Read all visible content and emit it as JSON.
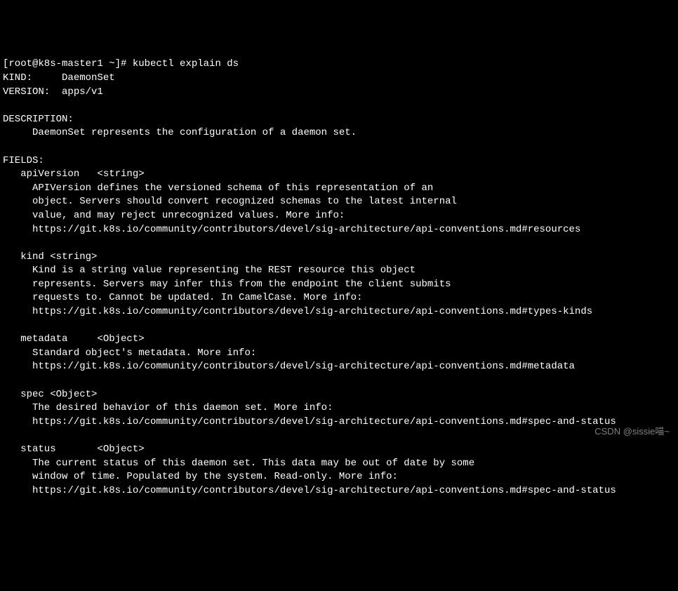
{
  "prompt": "[root@k8s-master1 ~]# kubectl explain ds",
  "kind_line": "KIND:     DaemonSet",
  "version_line": "VERSION:  apps/v1",
  "description_header": "DESCRIPTION:",
  "description_body": "     DaemonSet represents the configuration of a daemon set.",
  "fields_header": "FIELDS:",
  "apiVersion_title": "   apiVersion   <string>",
  "apiVersion_l1": "     APIVersion defines the versioned schema of this representation of an",
  "apiVersion_l2": "     object. Servers should convert recognized schemas to the latest internal",
  "apiVersion_l3": "     value, and may reject unrecognized values. More info:",
  "apiVersion_l4": "     https://git.k8s.io/community/contributors/devel/sig-architecture/api-conventions.md#resources",
  "kind_title": "   kind <string>",
  "kind_l1": "     Kind is a string value representing the REST resource this object",
  "kind_l2": "     represents. Servers may infer this from the endpoint the client submits",
  "kind_l3": "     requests to. Cannot be updated. In CamelCase. More info:",
  "kind_l4": "     https://git.k8s.io/community/contributors/devel/sig-architecture/api-conventions.md#types-kinds",
  "metadata_title": "   metadata     <Object>",
  "metadata_l1": "     Standard object's metadata. More info:",
  "metadata_l2": "     https://git.k8s.io/community/contributors/devel/sig-architecture/api-conventions.md#metadata",
  "spec_title": "   spec <Object>",
  "spec_l1": "     The desired behavior of this daemon set. More info:",
  "spec_l2": "     https://git.k8s.io/community/contributors/devel/sig-architecture/api-conventions.md#spec-and-status",
  "status_title": "   status       <Object>",
  "status_l1": "     The current status of this daemon set. This data may be out of date by some",
  "status_l2": "     window of time. Populated by the system. Read-only. More info:",
  "status_l3": "     https://git.k8s.io/community/contributors/devel/sig-architecture/api-conventions.md#spec-and-status",
  "watermark": "CSDN @sissie喵~"
}
